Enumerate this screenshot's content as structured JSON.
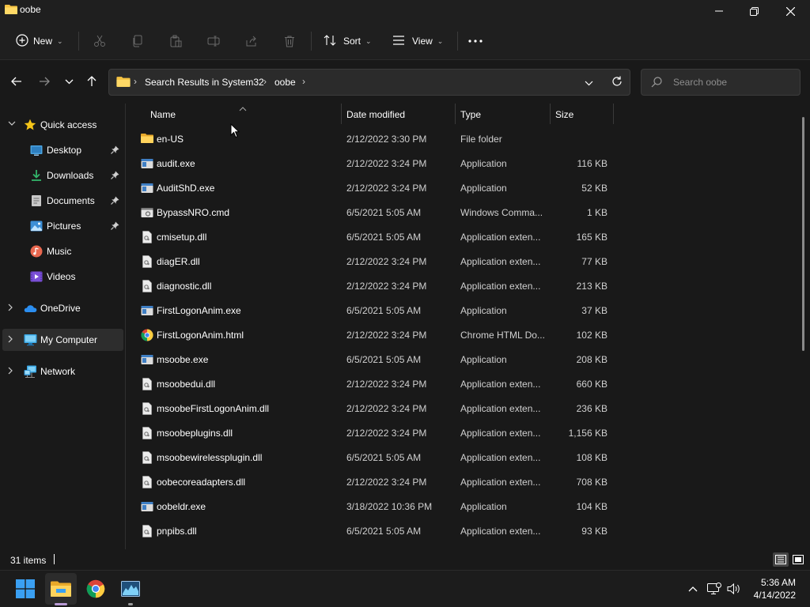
{
  "window": {
    "title": "oobe"
  },
  "toolbar": {
    "new_label": "New",
    "sort_label": "Sort",
    "view_label": "View"
  },
  "address": {
    "crumbs": [
      "Search Results in System32",
      "oobe"
    ]
  },
  "search": {
    "placeholder": "Search oobe"
  },
  "sidebar": {
    "items": [
      {
        "label": "Quick access",
        "icon": "star-icon"
      },
      {
        "label": "Desktop",
        "icon": "desktop-icon",
        "pinned": true
      },
      {
        "label": "Downloads",
        "icon": "download-icon",
        "pinned": true
      },
      {
        "label": "Documents",
        "icon": "documents-icon",
        "pinned": true
      },
      {
        "label": "Pictures",
        "icon": "pictures-icon",
        "pinned": true
      },
      {
        "label": "Music",
        "icon": "music-icon"
      },
      {
        "label": "Videos",
        "icon": "videos-icon"
      },
      {
        "label": "OneDrive",
        "icon": "cloud-icon"
      },
      {
        "label": "My Computer",
        "icon": "computer-icon",
        "selected": true
      },
      {
        "label": "Network",
        "icon": "network-icon"
      }
    ]
  },
  "columns": {
    "name": "Name",
    "date": "Date modified",
    "type": "Type",
    "size": "Size"
  },
  "files": [
    {
      "name": "en-US",
      "date": "2/12/2022 3:30 PM",
      "type": "File folder",
      "size": "",
      "icon": "folder-icon"
    },
    {
      "name": "audit.exe",
      "date": "2/12/2022 3:24 PM",
      "type": "Application",
      "size": "116 KB",
      "icon": "exe-icon"
    },
    {
      "name": "AuditShD.exe",
      "date": "2/12/2022 3:24 PM",
      "type": "Application",
      "size": "52 KB",
      "icon": "exe-icon"
    },
    {
      "name": "BypassNRO.cmd",
      "date": "6/5/2021 5:05 AM",
      "type": "Windows Comma...",
      "size": "1 KB",
      "icon": "cmd-icon"
    },
    {
      "name": "cmisetup.dll",
      "date": "6/5/2021 5:05 AM",
      "type": "Application exten...",
      "size": "165 KB",
      "icon": "dll-icon"
    },
    {
      "name": "diagER.dll",
      "date": "2/12/2022 3:24 PM",
      "type": "Application exten...",
      "size": "77 KB",
      "icon": "dll-icon"
    },
    {
      "name": "diagnostic.dll",
      "date": "2/12/2022 3:24 PM",
      "type": "Application exten...",
      "size": "213 KB",
      "icon": "dll-icon"
    },
    {
      "name": "FirstLogonAnim.exe",
      "date": "6/5/2021 5:05 AM",
      "type": "Application",
      "size": "37 KB",
      "icon": "exe-icon"
    },
    {
      "name": "FirstLogonAnim.html",
      "date": "2/12/2022 3:24 PM",
      "type": "Chrome HTML Do...",
      "size": "102 KB",
      "icon": "chrome-icon"
    },
    {
      "name": "msoobe.exe",
      "date": "6/5/2021 5:05 AM",
      "type": "Application",
      "size": "208 KB",
      "icon": "exe-icon"
    },
    {
      "name": "msoobedui.dll",
      "date": "2/12/2022 3:24 PM",
      "type": "Application exten...",
      "size": "660 KB",
      "icon": "dll-icon"
    },
    {
      "name": "msoobeFirstLogonAnim.dll",
      "date": "2/12/2022 3:24 PM",
      "type": "Application exten...",
      "size": "236 KB",
      "icon": "dll-icon"
    },
    {
      "name": "msoobeplugins.dll",
      "date": "2/12/2022 3:24 PM",
      "type": "Application exten...",
      "size": "1,156 KB",
      "icon": "dll-icon"
    },
    {
      "name": "msoobewirelessplugin.dll",
      "date": "6/5/2021 5:05 AM",
      "type": "Application exten...",
      "size": "108 KB",
      "icon": "dll-icon"
    },
    {
      "name": "oobecoreadapters.dll",
      "date": "2/12/2022 3:24 PM",
      "type": "Application exten...",
      "size": "708 KB",
      "icon": "dll-icon"
    },
    {
      "name": "oobeldr.exe",
      "date": "3/18/2022 10:36 PM",
      "type": "Application",
      "size": "104 KB",
      "icon": "exe-icon"
    },
    {
      "name": "pnpibs.dll",
      "date": "6/5/2021 5:05 AM",
      "type": "Application exten...",
      "size": "93 KB",
      "icon": "dll-icon"
    }
  ],
  "status": {
    "count": "31 items"
  },
  "clock": {
    "time": "5:36 AM",
    "date": "4/14/2022"
  },
  "colors": {
    "accent": "#4cc2ff",
    "folder": "#f5c242",
    "background": "#191919"
  }
}
